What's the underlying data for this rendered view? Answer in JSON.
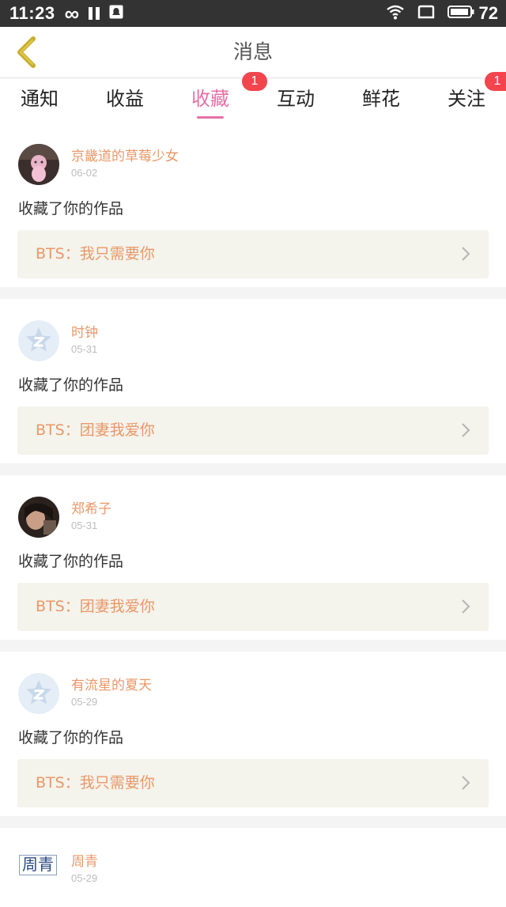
{
  "status_bar": {
    "time": "11:23",
    "battery": "72",
    "icons": [
      "infinity-icon",
      "pause-icon",
      "notification-app-icon",
      "wifi-icon",
      "screen-icon",
      "battery-icon"
    ]
  },
  "header": {
    "title": "消息",
    "back_icon": "chevron-left-icon"
  },
  "tabs": [
    {
      "label": "通知",
      "active": false,
      "badge": ""
    },
    {
      "label": "收益",
      "active": false,
      "badge": ""
    },
    {
      "label": "收藏",
      "active": true,
      "badge": "1"
    },
    {
      "label": "互动",
      "active": false,
      "badge": ""
    },
    {
      "label": "鲜花",
      "active": false,
      "badge": ""
    },
    {
      "label": "关注",
      "active": false,
      "badge": "1"
    }
  ],
  "colors": {
    "accent": "#e86fa6",
    "name": "#e99868",
    "badge": "#f2454d",
    "card_work_bg": "#f4f3ec"
  },
  "items": [
    {
      "user": "京畿道的草莓少女",
      "date": "06-02",
      "action": "收藏了你的作品",
      "work": "BTS：我只需要你",
      "avatar": "photo-avatar"
    },
    {
      "user": "时钟",
      "date": "05-31",
      "action": "收藏了你的作品",
      "work": "BTS：团妻我爱你",
      "avatar": "default-z-avatar"
    },
    {
      "user": "郑希子",
      "date": "05-31",
      "action": "收藏了你的作品",
      "work": "BTS：团妻我爱你",
      "avatar": "photo-avatar"
    },
    {
      "user": "有流星的夏天",
      "date": "05-29",
      "action": "收藏了你的作品",
      "work": "BTS：我只需要你",
      "avatar": "default-z-avatar"
    },
    {
      "user": "周青",
      "date": "05-29",
      "avatar": "text-avatar",
      "avatar_text": "周青"
    }
  ]
}
